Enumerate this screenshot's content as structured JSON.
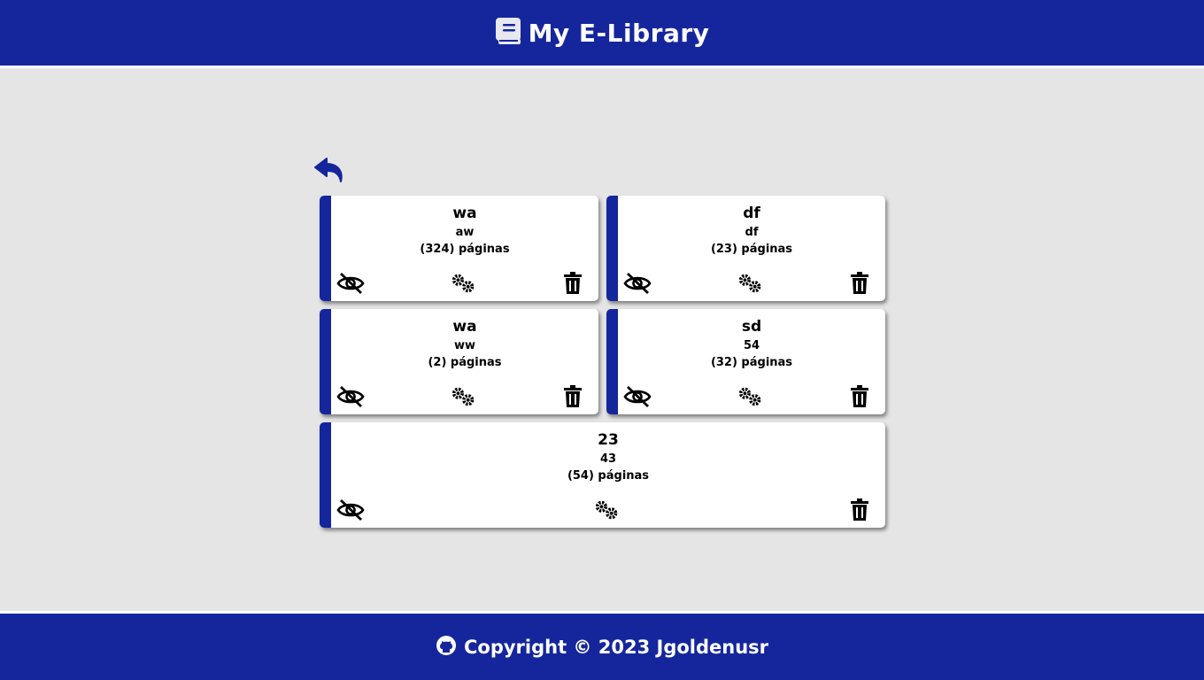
{
  "header": {
    "title": "My E-Library",
    "logo_icon": "book-icon"
  },
  "navigation": {
    "back_icon": "reply-arrow-icon"
  },
  "books": [
    {
      "title": "wa",
      "author": "aw",
      "pages": "(324) páginas"
    },
    {
      "title": "df",
      "author": "df",
      "pages": "(23) páginas"
    },
    {
      "title": "wa",
      "author": "ww",
      "pages": "(2) páginas"
    },
    {
      "title": "sd",
      "author": "54",
      "pages": "(32) páginas"
    },
    {
      "title": "23",
      "author": "43",
      "pages": "(54) páginas"
    }
  ],
  "card_actions": {
    "toggle_icon": "eye-slash-icon",
    "edit_icon": "gears-icon",
    "delete_icon": "trash-icon"
  },
  "footer": {
    "text": "Copyright © 2023 Jgoldenusr",
    "icon": "github-icon"
  },
  "colors": {
    "primary": "#15269d",
    "background": "#e5e5e5",
    "card": "#ffffff"
  }
}
